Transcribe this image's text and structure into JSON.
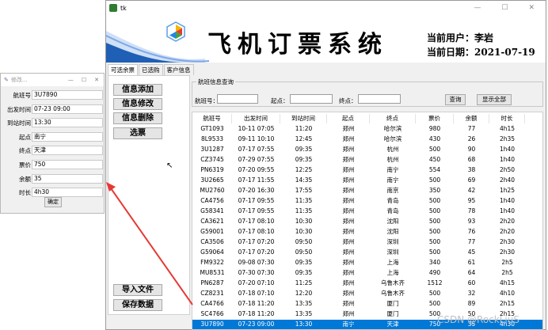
{
  "edit_window": {
    "title": "修改...",
    "fields": [
      {
        "label": "航班号",
        "value": "3U7890"
      },
      {
        "label": "出发时间",
        "value": "07-23 09:00"
      },
      {
        "label": "到站时间",
        "value": "13:30"
      },
      {
        "label": "起点",
        "value": "南宁"
      },
      {
        "label": "终点",
        "value": "天津"
      },
      {
        "label": "票价",
        "value": "750"
      },
      {
        "label": "余额",
        "value": "35"
      },
      {
        "label": "时长",
        "value": "4h30"
      }
    ],
    "confirm_label": "确定"
  },
  "main_window": {
    "title": "tk",
    "banner_title": "飞机订票系统",
    "current_user_label": "当前用户：李岩",
    "current_date_label": "当前日期：2021-07-19",
    "tabs": [
      "可选余票",
      "已选购",
      "客户信息"
    ],
    "left_buttons": [
      "信息添加",
      "信息修改",
      "信息删除",
      "选票"
    ],
    "bottom_buttons": [
      "导入文件",
      "保存数据"
    ],
    "query": {
      "group_title": "航班信息查询",
      "flight_label": "航班号：",
      "origin_label": "起点：",
      "dest_label": "终点：",
      "search_button": "查询",
      "show_all_button": "显示全部"
    },
    "table": {
      "columns": [
        "航班号",
        "出发时间",
        "到站时间",
        "起点",
        "终点",
        "票价",
        "余额",
        "时长"
      ],
      "rows": [
        [
          "GT1093",
          "10-11 07:05",
          "11:20",
          "郑州",
          "哈尔滨",
          "980",
          "77",
          "4h15"
        ],
        [
          "8L9533",
          "09-11 10:10",
          "12:45",
          "郑州",
          "哈尔滨",
          "430",
          "26",
          "2h35"
        ],
        [
          "3U1287",
          "07-17 07:55",
          "09:35",
          "郑州",
          "杭州",
          "500",
          "90",
          "1h40"
        ],
        [
          "CZ3745",
          "07-29 07:55",
          "09:35",
          "郑州",
          "杭州",
          "450",
          "68",
          "1h40"
        ],
        [
          "PN6319",
          "07-20 09:55",
          "12:25",
          "郑州",
          "南宁",
          "554",
          "38",
          "2h50"
        ],
        [
          "3U2665",
          "07-17 11:55",
          "14:35",
          "郑州",
          "南宁",
          "500",
          "69",
          "2h40"
        ],
        [
          "MU2760",
          "07-20 16:30",
          "17:55",
          "郑州",
          "南京",
          "350",
          "42",
          "1h25"
        ],
        [
          "CA4756",
          "07-17 09:55",
          "11:35",
          "郑州",
          "青岛",
          "500",
          "95",
          "1h40"
        ],
        [
          "G58341",
          "07-17 09:55",
          "11:35",
          "郑州",
          "青岛",
          "500",
          "78",
          "1h40"
        ],
        [
          "CA3621",
          "07-17 08:10",
          "10:30",
          "郑州",
          "沈阳",
          "500",
          "93",
          "2h20"
        ],
        [
          "G59001",
          "07-17 08:10",
          "10:30",
          "郑州",
          "沈阳",
          "500",
          "76",
          "2h20"
        ],
        [
          "CA3506",
          "07-17 07:20",
          "09:50",
          "郑州",
          "深圳",
          "500",
          "77",
          "2h30"
        ],
        [
          "G59064",
          "07-17 07:20",
          "09:50",
          "郑州",
          "深圳",
          "500",
          "45",
          "2h30"
        ],
        [
          "FM9322",
          "09-08 07:30",
          "09:35",
          "郑州",
          "上海",
          "340",
          "61",
          "2h5"
        ],
        [
          "MU8531",
          "07-30 07:30",
          "09:35",
          "郑州",
          "上海",
          "490",
          "64",
          "2h5"
        ],
        [
          "PN6287",
          "07-20 07:10",
          "11:25",
          "郑州",
          "乌鲁木齐",
          "1512",
          "60",
          "4h15"
        ],
        [
          "CZ8231",
          "07-18 07:10",
          "12:20",
          "郑州",
          "乌鲁木齐",
          "500",
          "32",
          "4h10"
        ],
        [
          "CA4766",
          "07-18 11:20",
          "13:35",
          "郑州",
          "厦门",
          "500",
          "89",
          "2h15"
        ],
        [
          "SC4766",
          "07-18 11:20",
          "13:35",
          "郑州",
          "厦门",
          "500",
          "50",
          "2h15"
        ],
        [
          "3U7890",
          "07-23 09:00",
          "13:30",
          "南宁",
          "天津",
          "750",
          "35",
          "4h30"
        ]
      ],
      "selected_row": 19
    }
  },
  "watermark": "CSDN @RockLiuS",
  "colors": {
    "selection": "#0078d7",
    "arrow": "#e53935",
    "banner_wave": "#1f5fb5"
  }
}
